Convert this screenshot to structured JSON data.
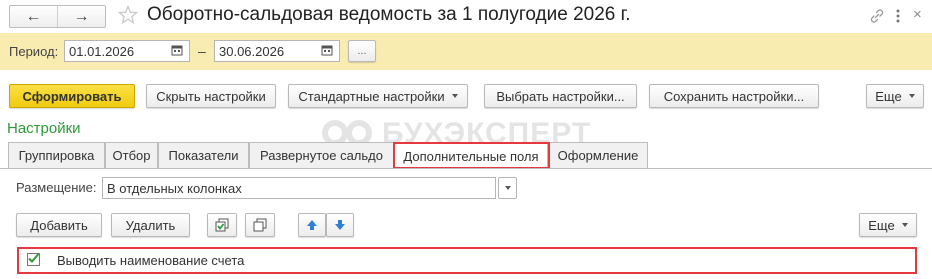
{
  "window": {
    "title": "Оборотно-сальдовая ведомость за 1 полугодие 2026 г.",
    "nav_back": "←",
    "nav_forward": "→",
    "favorite_icon": "star-outline-icon",
    "link_icon": "link-icon",
    "more_icon": "kebab-icon",
    "close": "×"
  },
  "period": {
    "label": "Период:",
    "from": "01.01.2026",
    "dash": "–",
    "to": "30.06.2026",
    "more": "..."
  },
  "toolbar": {
    "generate": "Сформировать",
    "hide_settings": "Скрыть настройки",
    "standard_settings": "Стандартные настройки",
    "choose_settings": "Выбрать настройки...",
    "save_settings": "Сохранить настройки...",
    "more": "Еще"
  },
  "settings_title": "Настройки",
  "watermark": "БУХЭКСПЕРТ",
  "tabs": [
    {
      "label": "Группировка"
    },
    {
      "label": "Отбор"
    },
    {
      "label": "Показатели"
    },
    {
      "label": "Развернутое сальдо"
    },
    {
      "label": "Дополнительные поля"
    },
    {
      "label": "Оформление"
    }
  ],
  "placement": {
    "label": "Размещение:",
    "value": "В отдельных колонках"
  },
  "list_toolbar": {
    "add": "Добавить",
    "delete": "Удалить",
    "more": "Еще"
  },
  "fields": [
    {
      "checked": true,
      "label": "Выводить наименование счета"
    }
  ],
  "colors": {
    "period_bar": "#f8ecb0",
    "primary_button": "#f5d320",
    "accent_green": "#2f9a3a",
    "highlight_red": "#e5393f",
    "arrow_blue": "#2f7fd6"
  }
}
